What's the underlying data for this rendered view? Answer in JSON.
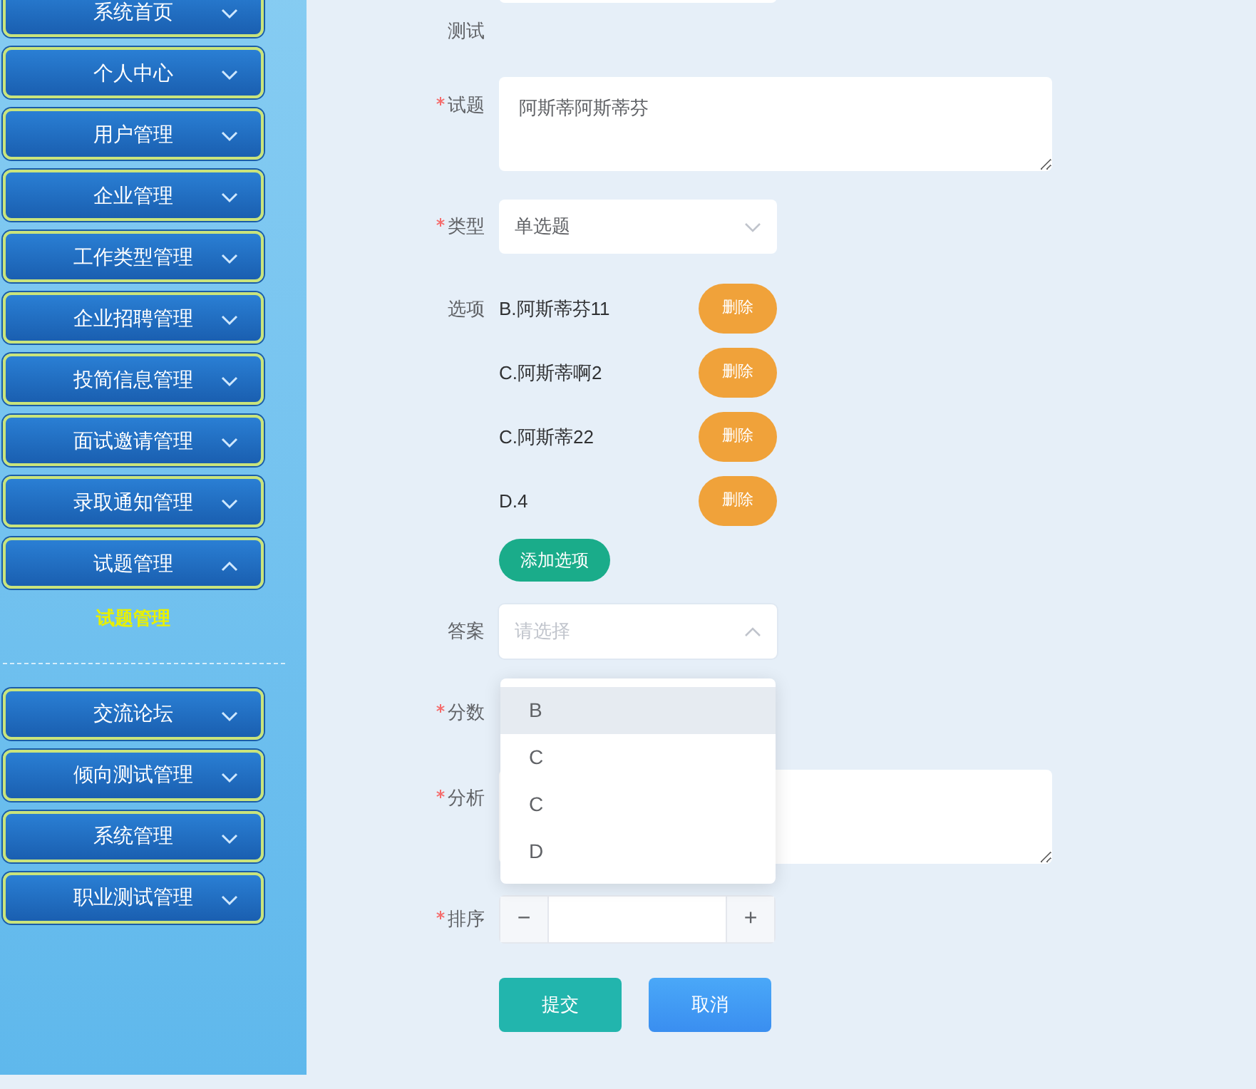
{
  "sidebar": {
    "items": [
      {
        "label": "系统首页",
        "expanded": false
      },
      {
        "label": "个人中心",
        "expanded": false
      },
      {
        "label": "用户管理",
        "expanded": false
      },
      {
        "label": "企业管理",
        "expanded": false
      },
      {
        "label": "工作类型管理",
        "expanded": false
      },
      {
        "label": "企业招聘管理",
        "expanded": false
      },
      {
        "label": "投简信息管理",
        "expanded": false
      },
      {
        "label": "面试邀请管理",
        "expanded": false
      },
      {
        "label": "录取通知管理",
        "expanded": false
      },
      {
        "label": "试题管理",
        "expanded": true,
        "children": [
          {
            "label": "试题管理"
          }
        ]
      },
      {
        "label": "交流论坛",
        "expanded": false
      },
      {
        "label": "倾向测试管理",
        "expanded": false
      },
      {
        "label": "系统管理",
        "expanded": false
      },
      {
        "label": "职业测试管理",
        "expanded": false
      }
    ]
  },
  "form": {
    "fields": [
      {
        "kind": "cut_input"
      },
      {
        "kind": "label_only",
        "label": "测试",
        "required": false
      },
      {
        "kind": "textarea",
        "label": "试题",
        "required": true,
        "value": "阿斯蒂阿斯蒂芬"
      },
      {
        "kind": "select",
        "label": "类型",
        "required": true,
        "value": "单选题",
        "open": false
      },
      {
        "kind": "options",
        "label": "选项",
        "required": false,
        "options": [
          {
            "text": "B.阿斯蒂芬11",
            "delete": "删除"
          },
          {
            "text": "C.阿斯蒂啊2",
            "delete": "删除"
          },
          {
            "text": "C.阿斯蒂22",
            "delete": "删除"
          },
          {
            "text": "D.4",
            "delete": "删除"
          }
        ],
        "add": "添加选项"
      },
      {
        "kind": "select",
        "label": "答案",
        "required": false,
        "placeholder": "请选择",
        "open": true,
        "dropdown": [
          {
            "label": "B",
            "hovered": true
          },
          {
            "label": "C",
            "hovered": false
          },
          {
            "label": "C",
            "hovered": false
          },
          {
            "label": "D",
            "hovered": false
          }
        ]
      },
      {
        "kind": "covered",
        "label": "分数",
        "required": true
      },
      {
        "kind": "textarea_short",
        "label": "分析",
        "required": true
      },
      {
        "kind": "number",
        "label": "排序",
        "required": true,
        "minus": "−",
        "plus": "+"
      }
    ],
    "buttons": [
      {
        "label": "提交",
        "kind": "submit"
      },
      {
        "label": "取消",
        "kind": "cancel"
      }
    ]
  }
}
